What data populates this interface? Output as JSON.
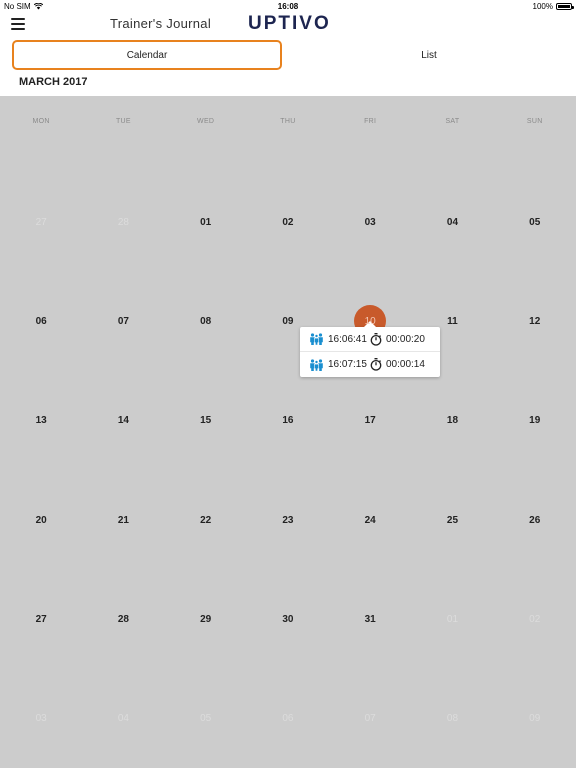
{
  "status_bar": {
    "carrier": "No SIM",
    "time": "16:08",
    "battery": "100%"
  },
  "nav": {
    "title": "Trainer's Journal",
    "logo": "UPTIVO"
  },
  "tabs": {
    "calendar": "Calendar",
    "list": "List",
    "active": "calendar"
  },
  "month_title": "MARCH 2017",
  "weekdays": [
    "MON",
    "TUE",
    "WED",
    "THU",
    "FRI",
    "SAT",
    "SUN"
  ],
  "weeks": [
    [
      "27",
      "28",
      "01",
      "02",
      "03",
      "04",
      "05"
    ],
    [
      "06",
      "07",
      "08",
      "09",
      "10",
      "11",
      "12"
    ],
    [
      "13",
      "14",
      "15",
      "16",
      "17",
      "18",
      "19"
    ],
    [
      "20",
      "21",
      "22",
      "23",
      "24",
      "25",
      "26"
    ],
    [
      "27",
      "28",
      "29",
      "30",
      "31",
      "01",
      "02"
    ],
    [
      "03",
      "04",
      "05",
      "06",
      "07",
      "08",
      "09"
    ]
  ],
  "muted_days": {
    "0": [
      0,
      1
    ],
    "4": [
      5,
      6
    ],
    "5": [
      0,
      1,
      2,
      3,
      4,
      5,
      6
    ]
  },
  "selected_day": {
    "week": 1,
    "day": 4
  },
  "sessions": [
    {
      "start": "16:06:41",
      "duration": "00:00:20",
      "icon": "group-icon",
      "duration_icon": "stopwatch-icon"
    },
    {
      "start": "16:07:15",
      "duration": "00:00:14",
      "icon": "group-icon",
      "duration_icon": "stopwatch-icon"
    }
  ],
  "colors": {
    "accent": "#e8821e",
    "selected_day": "#c85a2b",
    "icon_blue": "#1a8fd0",
    "calendar_bg": "#cccccc",
    "logo": "#1d2550"
  }
}
